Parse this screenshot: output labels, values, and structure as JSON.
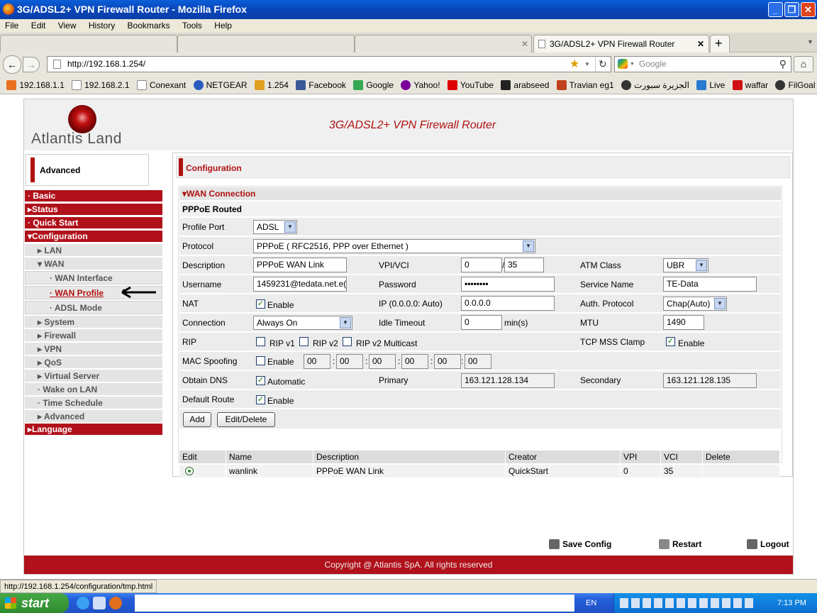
{
  "window": {
    "title": "3G/ADSL2+ VPN Firewall Router - Mozilla Firefox"
  },
  "menu": [
    "File",
    "Edit",
    "View",
    "History",
    "Bookmarks",
    "Tools",
    "Help"
  ],
  "tab": {
    "label": "3G/ADSL2+ VPN Firewall Router"
  },
  "address": {
    "url": "http://192.168.1.254/",
    "search_placeholder": "Google"
  },
  "bookmarks": [
    "192.168.1.1",
    "192.168.2.1",
    "Conexant",
    "NETGEAR",
    "1.254",
    "Facebook",
    "Google",
    "Yahoo!",
    "YouTube",
    "arabseed",
    "Travian eg1",
    "الجزيرة سبورت",
    "Live",
    "waffar",
    "FilGoal"
  ],
  "header": {
    "logo": "Atlantis Land",
    "title": "3G/ADSL2+ VPN Firewall Router"
  },
  "sidebar": {
    "mode": "Advanced",
    "items": {
      "basic": "· Basic",
      "status": "▸Status",
      "quick_start": "· Quick Start",
      "configuration": "▾Configuration",
      "lan": "▸ LAN",
      "wan": "▾ WAN",
      "wan_interface": "· WAN Interface",
      "wan_profile": "· WAN Profile",
      "adsl_mode": "· ADSL Mode",
      "system": "▸ System",
      "firewall": "▸ Firewall",
      "vpn": "▸ VPN",
      "qos": "▸ QoS",
      "virtual_server": "▸ Virtual Server",
      "wake_on_lan": "· Wake on LAN",
      "time_schedule": "· Time Schedule",
      "advanced": "▸ Advanced",
      "language": "▸Language"
    }
  },
  "main": {
    "section_title": "Configuration",
    "box_title": "▾WAN Connection",
    "subtitle": "PPPoE Routed",
    "labels": {
      "profile_port": "Profile Port",
      "protocol": "Protocol",
      "description": "Description",
      "vpi_vci": "VPI/VCI",
      "atm_class": "ATM Class",
      "username": "Username",
      "password": "Password",
      "service_name": "Service Name",
      "nat": "NAT",
      "ip": "IP (0.0.0.0: Auto)",
      "auth_protocol": "Auth. Protocol",
      "connection": "Connection",
      "idle_timeout": "Idle Timeout",
      "mins": "min(s)",
      "mtu": "MTU",
      "rip": "RIP",
      "rip_v1": "RIP v1",
      "rip_v2": "RIP v2",
      "rip_v2_multicast": "RIP v2 Multicast",
      "tcp_mss_clamp": "TCP MSS Clamp",
      "mac_spoofing": "MAC Spoofing",
      "obtain_dns": "Obtain DNS",
      "automatic": "Automatic",
      "primary": "Primary",
      "secondary": "Secondary",
      "default_route": "Default Route",
      "enable": "Enable"
    },
    "values": {
      "profile_port": "ADSL",
      "protocol": "PPPoE ( RFC2516, PPP over Ethernet )",
      "description": "PPPoE WAN Link",
      "vpi": "0",
      "vci": "35",
      "atm_class": "UBR",
      "username": "1459231@tedata.net.e(",
      "password": "••••••••",
      "service_name": "TE-Data",
      "ip": "0.0.0.0",
      "auth_protocol": "Chap(Auto)",
      "connection": "Always On",
      "idle_timeout": "0",
      "mtu": "1490",
      "mac": [
        "00",
        "00",
        "00",
        "00",
        "00",
        "00"
      ],
      "primary_dns": "163.121.128.134",
      "secondary_dns": "163.121.128.135"
    },
    "buttons": {
      "add": "Add",
      "edit_delete": "Edit/Delete"
    },
    "table": {
      "headers": [
        "Edit",
        "Name",
        "Description",
        "Creator",
        "VPI",
        "VCI",
        "Delete"
      ],
      "row": {
        "name": "wanlink",
        "description": "PPPoE WAN Link",
        "creator": "QuickStart",
        "vpi": "0",
        "vci": "35"
      }
    }
  },
  "actions": {
    "save": "Save Config",
    "restart": "Restart",
    "logout": "Logout"
  },
  "footer": "Copyright @ Atlantis SpA. All rights reserved",
  "status": "http://192.168.1.254/configuration/tmp.html",
  "taskbar": {
    "start": "start",
    "lang": "EN",
    "time": "7:13 PM"
  },
  "colors": {
    "brand_red": "#b0111a",
    "title_red": "#b01010"
  }
}
